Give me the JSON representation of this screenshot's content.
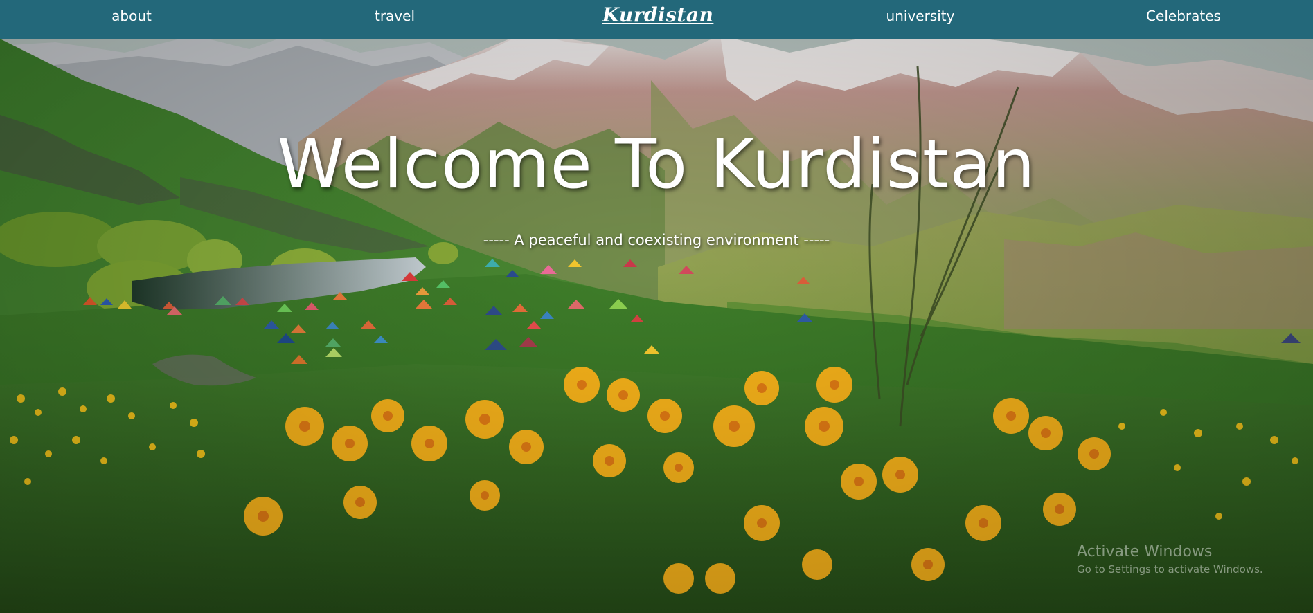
{
  "nav": {
    "about": "about",
    "travel": "travel",
    "brand": "Kurdistan",
    "university": "university",
    "celebrates": "Celebrates"
  },
  "hero": {
    "title": "Welcome To Kurdistan",
    "subtitle": "----- A peaceful and coexisting environment -----"
  },
  "watermark": {
    "title": "Activate Windows",
    "subtitle": "Go to Settings to activate Windows."
  },
  "colors": {
    "navbar": "#23687a",
    "text": "#ffffff"
  }
}
